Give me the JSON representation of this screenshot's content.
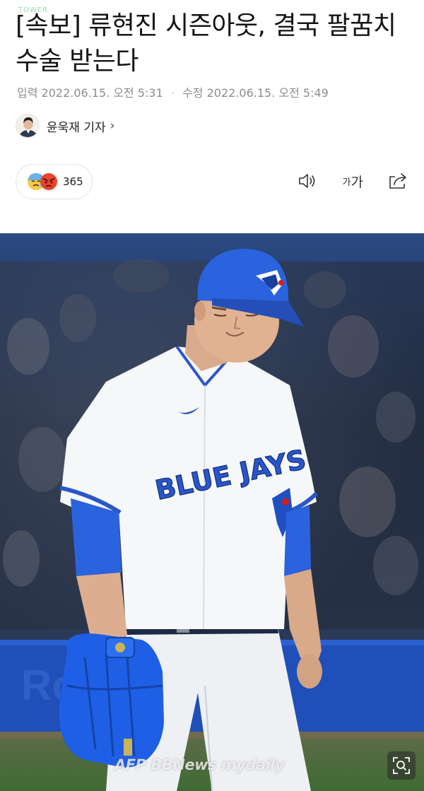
{
  "site_mark": "TOWER",
  "article": {
    "headline": "[속보] 류현진 시즌아웃, 결국 팔꿈치 수술 받는다",
    "date_input_label": "입력",
    "date_input_value": "2022.06.15. 오전 5:31",
    "date_separator": "·",
    "date_edit_label": "수정",
    "date_edit_value": "2022.06.15. 오전 5:49"
  },
  "author": {
    "name": "윤욱재 기자",
    "chevron": "›"
  },
  "reactions": {
    "count": "365",
    "icons": [
      "sad-face-icon",
      "angry-face-icon"
    ]
  },
  "toolbar": {
    "audio_icon": "speaker-icon",
    "font_small": "가",
    "font_large": "가",
    "share_icon": "share-icon"
  },
  "photo": {
    "jersey_text": "BLUE JAYS",
    "credit": "AFP BBNews mydaily",
    "zoom_icon": "zoom-icon"
  },
  "colors": {
    "royal_blue": "#1f5fd8",
    "navy": "#1b3f8f",
    "text_gray": "#8c8c8c"
  }
}
